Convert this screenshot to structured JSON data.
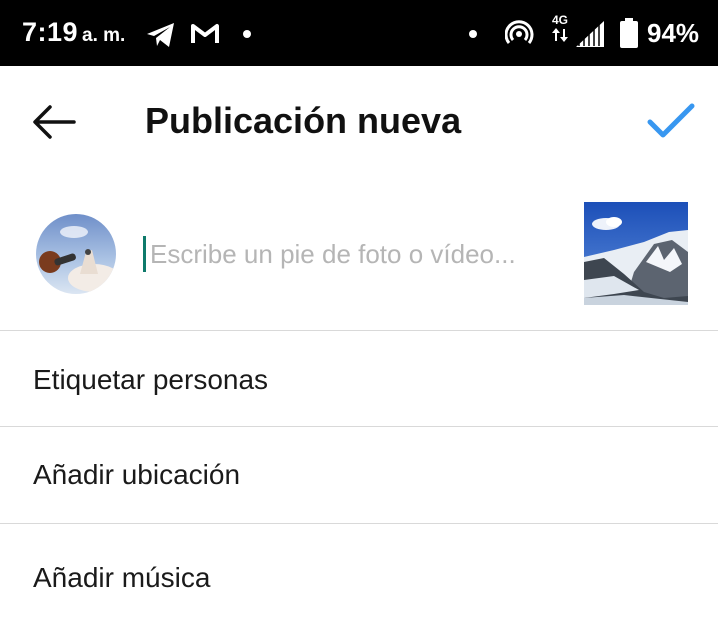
{
  "status_bar": {
    "time": "7:19",
    "ampm": "a. m.",
    "network": "4G",
    "battery": "94%"
  },
  "header": {
    "title": "Publicación nueva",
    "back_icon": "arrow-left-icon",
    "confirm_icon": "checkmark-icon",
    "accent_color": "#3897f0"
  },
  "caption": {
    "placeholder": "Escribe un pie de foto o vídeo...",
    "value": ""
  },
  "options": [
    {
      "label": "Etiquetar personas"
    },
    {
      "label": "Añadir ubicación"
    },
    {
      "label": "Añadir música"
    }
  ]
}
